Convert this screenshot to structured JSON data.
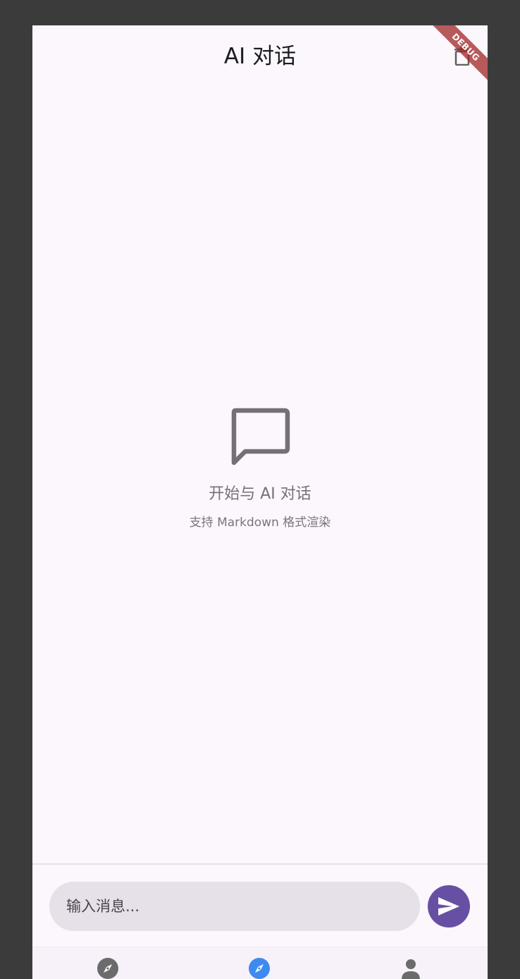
{
  "appbar": {
    "title": "AI 对话",
    "action_icon": "delete-icon"
  },
  "debug_banner": {
    "label": "DEBUG",
    "color": "#a02626"
  },
  "empty_state": {
    "icon": "chat-bubble-outline-icon",
    "title": "开始与 AI 对话",
    "subtitle": "支持 Markdown 格式渲染"
  },
  "composer": {
    "placeholder": "输入消息...",
    "value": "",
    "send_icon": "send-icon",
    "send_color": "#6750a4"
  },
  "bottom_nav": {
    "items": [
      {
        "icon": "compass-icon",
        "active": false,
        "color": "#6b6b6b"
      },
      {
        "icon": "compass-icon",
        "active": true,
        "color": "#3d8bf0"
      },
      {
        "icon": "person-icon",
        "active": false,
        "color": "#6b6b6b"
      }
    ]
  },
  "colors": {
    "background": "#fcf7fd",
    "outer": "#3b3b3b",
    "text_secondary": "#757078",
    "input_fill": "#e6e0e8"
  }
}
